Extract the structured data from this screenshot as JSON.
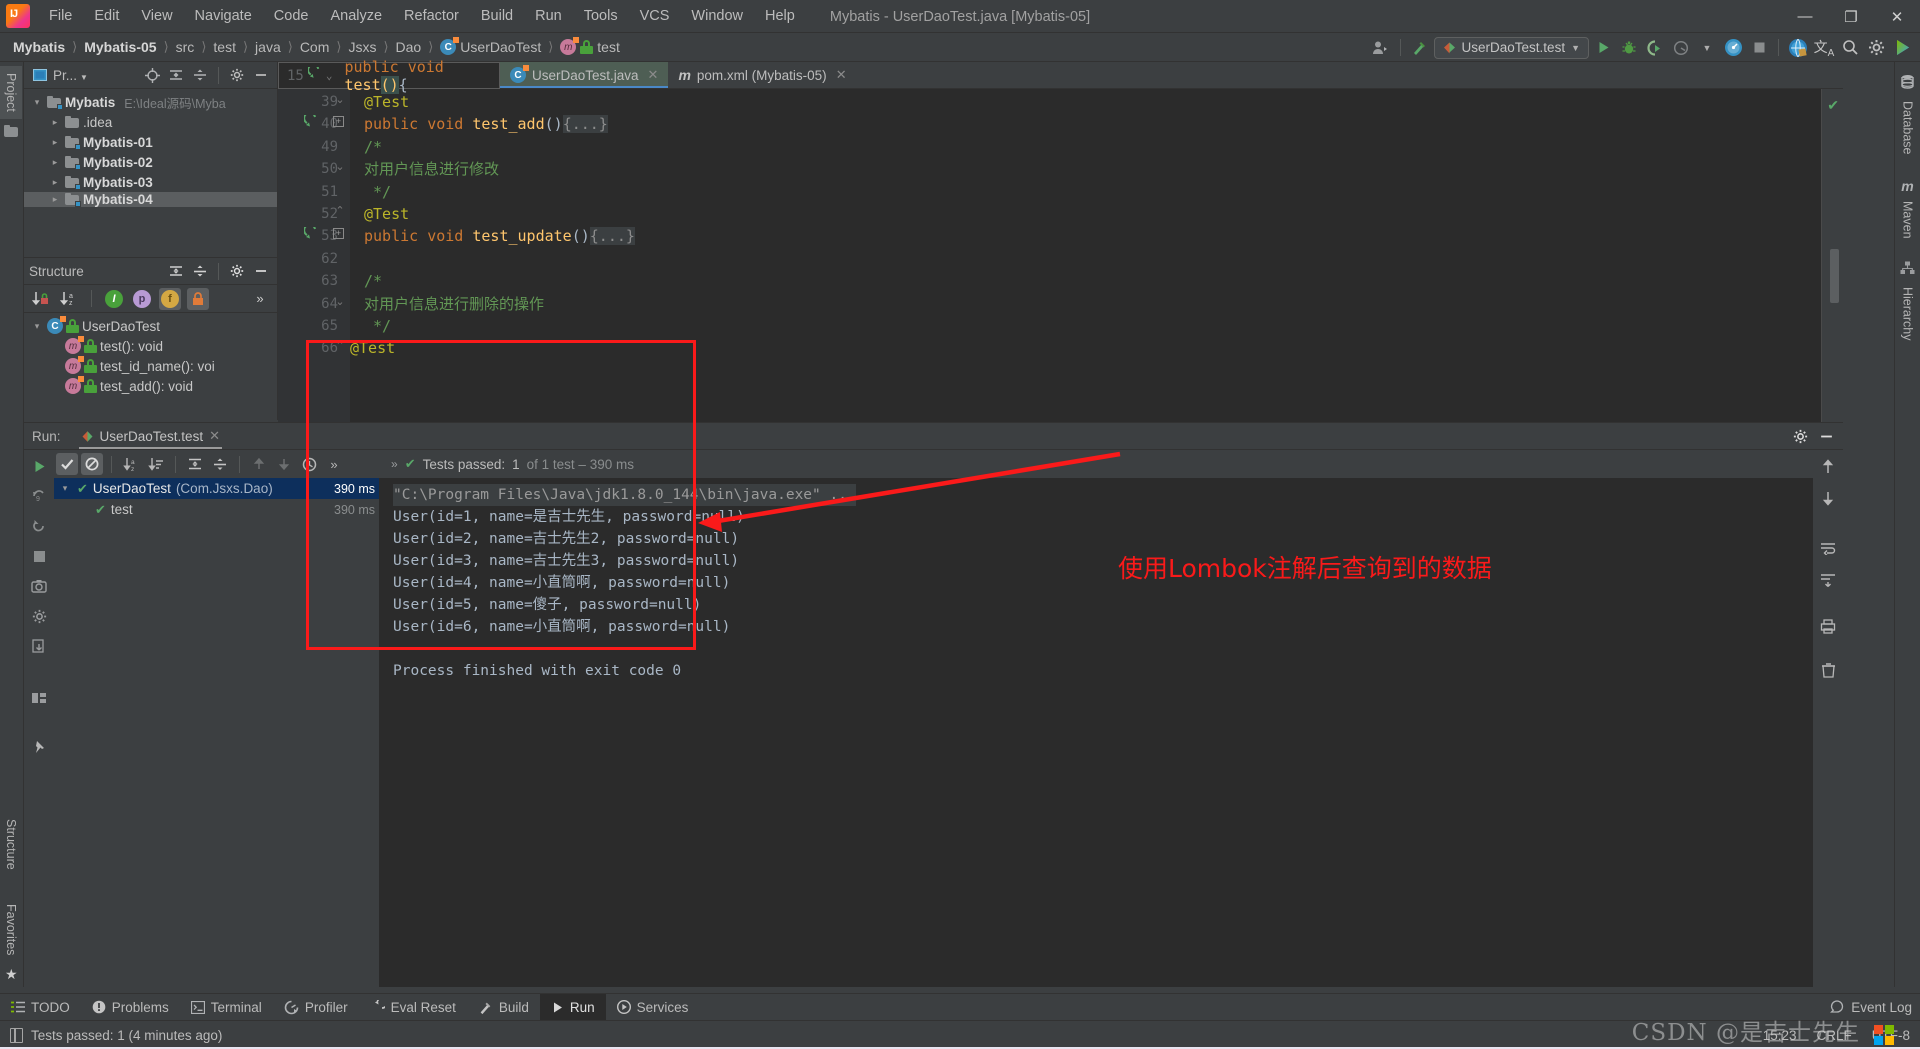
{
  "window": {
    "title": "Mybatis - UserDaoTest.java [Mybatis-05]",
    "minimize": "—",
    "maximize": "❐",
    "close": "✕"
  },
  "menubar": {
    "items": [
      "File",
      "Edit",
      "View",
      "Navigate",
      "Code",
      "Analyze",
      "Refactor",
      "Build",
      "Run",
      "Tools",
      "VCS",
      "Window",
      "Help"
    ]
  },
  "breadcrumb": {
    "items": [
      {
        "label": "Mybatis",
        "bold": true,
        "icon": ""
      },
      {
        "label": "Mybatis-05",
        "bold": true,
        "icon": ""
      },
      {
        "label": "src",
        "bold": false,
        "icon": ""
      },
      {
        "label": "test",
        "bold": false,
        "icon": ""
      },
      {
        "label": "java",
        "bold": false,
        "icon": ""
      },
      {
        "label": "Com",
        "bold": false,
        "icon": ""
      },
      {
        "label": "Jsxs",
        "bold": false,
        "icon": ""
      },
      {
        "label": "Dao",
        "bold": false,
        "icon": ""
      },
      {
        "label": "UserDaoTest",
        "bold": false,
        "icon": "class-icon"
      },
      {
        "label": "test",
        "bold": false,
        "icon": "method-icon"
      }
    ],
    "separator": "❯"
  },
  "toolbar": {
    "run_config_name": "UserDaoTest.test",
    "run_config_chevron": "▼",
    "profile_chevron": "▼",
    "icons": [
      {
        "name": "user-avatar-icon",
        "glyph": "👤"
      },
      {
        "name": "build-hammer-icon",
        "glyph": "◣"
      },
      {
        "name": "run-button",
        "glyph": "▶"
      },
      {
        "name": "debug-button",
        "glyph": "🐞"
      },
      {
        "name": "run-coverage-icon",
        "glyph": "◖"
      },
      {
        "name": "profiler-icon",
        "glyph": "◔"
      },
      {
        "name": "profiler-dropdown-icon",
        "glyph": "▼"
      },
      {
        "name": "attach-profiler-icon",
        "glyph": "◕"
      },
      {
        "name": "stop-button",
        "glyph": "■"
      },
      {
        "name": "globe-icon",
        "glyph": "◍"
      },
      {
        "name": "translate-icon",
        "glyph": "文A"
      },
      {
        "name": "search-everywhere-icon",
        "glyph": "🔍"
      },
      {
        "name": "settings-gear-icon",
        "glyph": "✿"
      },
      {
        "name": "ide-features-icon",
        "glyph": "▶"
      }
    ]
  },
  "left_strip": {
    "tabs": [
      {
        "label": "Project",
        "name": "tool-tab-project",
        "active": true
      },
      {
        "label": "Structure",
        "name": "tool-tab-structure",
        "active": false
      },
      {
        "label": "Favorites",
        "name": "tool-tab-favorites",
        "active": false
      }
    ],
    "star_icon": "★"
  },
  "right_strip": {
    "tabs": [
      {
        "label": "Database",
        "name": "tool-tab-database",
        "icon": "database-icon"
      },
      {
        "label": "Maven",
        "name": "tool-tab-maven",
        "icon": "maven-icon"
      },
      {
        "label": "Hierarchy",
        "name": "tool-tab-hierarchy",
        "icon": "hierarchy-icon"
      }
    ]
  },
  "project_panel": {
    "title": "Pr...",
    "title_chevron": "▼",
    "header_icons": [
      {
        "name": "locate-in-tree-icon",
        "glyph": "⊕"
      },
      {
        "name": "expand-all-icon",
        "glyph": "⇟"
      },
      {
        "name": "collapse-all-icon",
        "glyph": "⇞"
      },
      {
        "name": "panel-settings-icon",
        "glyph": "✿"
      },
      {
        "name": "hide-panel-icon",
        "glyph": "—"
      }
    ],
    "tree": [
      {
        "label": "Mybatis",
        "path": "E:\\Ideal源码\\Myba",
        "expanded": true,
        "indent": 1,
        "bold": true,
        "module": true
      },
      {
        "label": ".idea",
        "path": "",
        "expanded": false,
        "indent": 2,
        "bold": false,
        "module": false
      },
      {
        "label": "Mybatis-01",
        "path": "",
        "expanded": false,
        "indent": 2,
        "bold": true,
        "module": true
      },
      {
        "label": "Mybatis-02",
        "path": "",
        "expanded": false,
        "indent": 2,
        "bold": true,
        "module": true
      },
      {
        "label": "Mybatis-03",
        "path": "",
        "expanded": false,
        "indent": 2,
        "bold": true,
        "module": true
      },
      {
        "label": "Mybatis-04",
        "path": "",
        "expanded": false,
        "indent": 2,
        "bold": true,
        "module": true
      }
    ]
  },
  "structure_panel": {
    "title": "Structure",
    "header_icons": [
      {
        "name": "expand-all-icon",
        "glyph": "⇟"
      },
      {
        "name": "collapse-all-icon",
        "glyph": "⇞"
      },
      {
        "name": "panel-settings-icon",
        "glyph": "✿"
      },
      {
        "name": "hide-panel-icon",
        "glyph": "—"
      }
    ],
    "toolbar_icons": [
      {
        "name": "sort-by-visibility-icon",
        "glyph": "↓"
      },
      {
        "name": "sort-alphabetically-icon",
        "glyph": "↓"
      },
      {
        "name": "show-inherited-icon",
        "glyph": "I",
        "color": "#49a13b"
      },
      {
        "name": "show-properties-icon",
        "glyph": "p",
        "color": "#b89ad4"
      },
      {
        "name": "show-fields-icon",
        "glyph": "f",
        "color": "#d4a843",
        "on": true
      },
      {
        "name": "show-non-public-icon",
        "glyph": "🔒",
        "color": "#e07b39",
        "on": true
      },
      {
        "name": "more-options-icon",
        "glyph": "»"
      }
    ],
    "tree": [
      {
        "label": "UserDaoTest",
        "indent": 1,
        "expanded": true,
        "icon": "class-icon"
      },
      {
        "label": "test(): void",
        "indent": 2,
        "expanded": false,
        "icon": "method-icon"
      },
      {
        "label": "test_id_name(): voi",
        "indent": 2,
        "expanded": false,
        "icon": "method-icon"
      },
      {
        "label": "test_add(): void",
        "indent": 2,
        "expanded": false,
        "icon": "method-icon"
      }
    ]
  },
  "editor": {
    "tabs": [
      {
        "label": "UserDaoTest.java",
        "active": true,
        "icon": "class-icon",
        "close": "✕"
      },
      {
        "label": "pom.xml (Mybatis-05)",
        "active": false,
        "icon": "maven-icon",
        "close": "✕"
      }
    ],
    "sticky_line_number": "15",
    "sticky_code": "public void test(){",
    "lines": [
      {
        "num": "39",
        "text": "@Test",
        "kind": "anno",
        "runmark": false,
        "fold": "",
        "clipped": true
      },
      {
        "num": "40",
        "text": "public void test_add(){...}",
        "kind": "method-collapsed",
        "runmark": true,
        "fold": "plus"
      },
      {
        "num": "49",
        "text": "/*",
        "kind": "comment",
        "runmark": false,
        "fold": "dash"
      },
      {
        "num": "50",
        "text": "对用户信息进行修改",
        "kind": "comment",
        "runmark": false,
        "fold": ""
      },
      {
        "num": "51",
        "text": " */",
        "kind": "comment",
        "runmark": false,
        "fold": "end"
      },
      {
        "num": "52",
        "text": "@Test",
        "kind": "anno",
        "runmark": false,
        "fold": ""
      },
      {
        "num": "53",
        "text": "public void test_update(){...}",
        "kind": "method-collapsed",
        "runmark": true,
        "fold": "plus"
      },
      {
        "num": "62",
        "text": "",
        "kind": "blank",
        "runmark": false,
        "fold": ""
      },
      {
        "num": "63",
        "text": "/*",
        "kind": "comment",
        "runmark": false,
        "fold": "dash"
      },
      {
        "num": "64",
        "text": "对用户信息进行删除的操作",
        "kind": "comment",
        "runmark": false,
        "fold": ""
      },
      {
        "num": "65",
        "text": " */",
        "kind": "comment",
        "runmark": false,
        "fold": "end"
      },
      {
        "num": "66",
        "text": "@Test",
        "kind": "anno-left",
        "runmark": false,
        "fold": ""
      }
    ],
    "no_errors_icon": "✔"
  },
  "run_panel": {
    "label": "Run:",
    "tab_label": "UserDaoTest.test",
    "tab_close": "✕",
    "header_right_icons": [
      {
        "name": "run-settings-gear-icon",
        "glyph": "✿"
      },
      {
        "name": "hide-run-panel-icon",
        "glyph": "—"
      }
    ],
    "left_toolbar_icons": [
      {
        "name": "rerun-button",
        "glyph": "▶"
      },
      {
        "name": "rerun-failed-tests-button",
        "glyph": "↻"
      },
      {
        "name": "stop-button",
        "glyph": "■"
      },
      {
        "name": "screenshot-button",
        "glyph": "▣"
      },
      {
        "name": "settings-button",
        "glyph": "✿"
      },
      {
        "name": "export-button",
        "glyph": "⬓"
      },
      {
        "name": "layout-button",
        "glyph": "▦"
      },
      {
        "name": "pin-tab-button",
        "glyph": "📌"
      }
    ],
    "tests_toolbar_icons": [
      {
        "name": "show-passed-toggle",
        "glyph": "✔",
        "on": true
      },
      {
        "name": "show-ignored-toggle",
        "glyph": "⊘",
        "on": true
      },
      {
        "name": "sort-alphabetically-icon",
        "glyph": "↓a"
      },
      {
        "name": "sort-by-duration-icon",
        "glyph": "↓≡"
      },
      {
        "name": "expand-all-icon",
        "glyph": "⇟"
      },
      {
        "name": "collapse-all-icon",
        "glyph": "⇞"
      },
      {
        "name": "prev-failed-test-icon",
        "glyph": "↑",
        "dim": true
      },
      {
        "name": "next-failed-test-icon",
        "glyph": "↓",
        "dim": true
      },
      {
        "name": "test-history-icon",
        "glyph": "🕑"
      },
      {
        "name": "more-options-icon",
        "glyph": "»"
      }
    ],
    "tests": [
      {
        "label": "UserDaoTest",
        "package": "(Com.Jsxs.Dao)",
        "time": "390 ms",
        "selected": true,
        "expanded": true,
        "indent": 1
      },
      {
        "label": "test",
        "package": "",
        "time": "390 ms",
        "selected": false,
        "expanded": false,
        "indent": 2
      }
    ],
    "status": {
      "expand_glyph": "»",
      "check": "✔",
      "passed_label": "Tests passed:",
      "passed_count": "1",
      "of_label": "of 1 test – 390 ms"
    },
    "console": [
      {
        "text": "\"C:\\Program Files\\Java\\jdk1.8.0_144\\bin\\java.exe\" ...",
        "cmd": true
      },
      {
        "text": "User(id=1, name=是吉士先生, password=null)",
        "cmd": false
      },
      {
        "text": "User(id=2, name=吉士先生2, password=null)",
        "cmd": false
      },
      {
        "text": "User(id=3, name=吉士先生3, password=null)",
        "cmd": false
      },
      {
        "text": "User(id=4, name=小直筒啊, password=null)",
        "cmd": false
      },
      {
        "text": "User(id=5, name=傻子, password=null)",
        "cmd": false
      },
      {
        "text": "User(id=6, name=小直筒啊, password=null)",
        "cmd": false
      },
      {
        "text": "",
        "cmd": false
      },
      {
        "text": "Process finished with exit code 0",
        "cmd": false
      }
    ],
    "console_right_icons": [
      {
        "name": "scroll-up-icon",
        "glyph": "↑"
      },
      {
        "name": "scroll-down-icon",
        "glyph": "↓"
      },
      {
        "name": "soft-wrap-icon",
        "glyph": "⏎"
      },
      {
        "name": "scroll-to-end-icon",
        "glyph": "⤓"
      },
      {
        "name": "print-icon",
        "glyph": "🖨"
      },
      {
        "name": "clear-all-icon",
        "glyph": "🗑"
      }
    ]
  },
  "annotation": {
    "text": "使用Lombok注解后查询到的数据",
    "color": "#fa1a1a"
  },
  "tool_window_bar": {
    "items": [
      {
        "label": "TODO",
        "icon": "todo-list-icon",
        "active": false
      },
      {
        "label": "Problems",
        "icon": "problems-warning-icon",
        "active": false
      },
      {
        "label": "Terminal",
        "icon": "terminal-icon",
        "active": false
      },
      {
        "label": "Profiler",
        "icon": "profiler-icon",
        "active": false
      },
      {
        "label": "Eval Reset",
        "icon": "eval-reset-icon",
        "active": false
      },
      {
        "label": "Build",
        "icon": "build-hammer-icon",
        "active": false
      },
      {
        "label": "Run",
        "icon": "run-play-icon",
        "active": true
      },
      {
        "label": "Services",
        "icon": "services-icon",
        "active": false
      }
    ],
    "event_log": {
      "label": "Event Log",
      "icon": "event-log-icon"
    }
  },
  "status_bar": {
    "message": "Tests passed: 1 (4 minutes ago)",
    "time": "15:23",
    "line_separator": "CRLF",
    "encoding": "UTF-8",
    "watermark": "CSDN @是吉士先生"
  },
  "colors": {
    "accent_blue": "#4a88c7",
    "green": "#59a869",
    "annotation_red": "#fa1a1a",
    "editor_bg": "#2b2b2b",
    "chrome_bg": "#3c3f41"
  }
}
